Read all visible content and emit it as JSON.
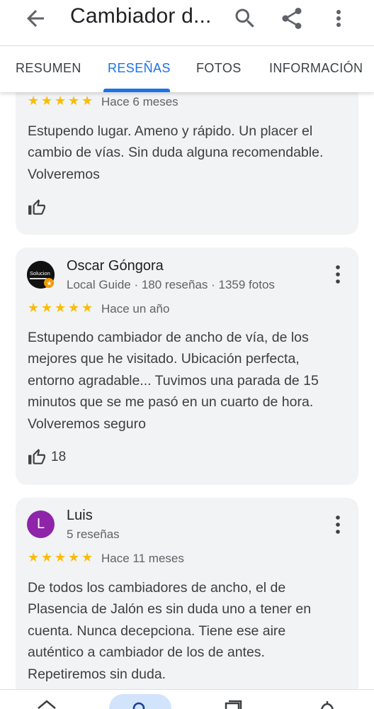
{
  "appbar": {
    "title": "Cambiador d...",
    "icons": [
      "back-arrow-icon",
      "search-icon",
      "share-icon",
      "more-vert-icon"
    ]
  },
  "tabs": [
    {
      "label": "RESUMEN",
      "active": false
    },
    {
      "label": "RESEÑAS",
      "active": true
    },
    {
      "label": "FOTOS",
      "active": false
    },
    {
      "label": "INFORMACIÓN",
      "active": false
    }
  ],
  "reviews": [
    {
      "rating": 5,
      "date": "Hace 6 meses",
      "text_lines": [
        "Estupendo lugar. Ameno y rápido. Un placer el",
        "cambio de vías. Sin duda alguna recomendable.",
        "Volveremos"
      ],
      "likes": ""
    },
    {
      "author": "Oscar Góngora",
      "author_meta": "Local Guide · 180 reseñas · 1359 fotos",
      "avatar_text": "Solucion",
      "rating": 5,
      "date": "Hace un año",
      "text_lines": [
        "Estupendo cambiador de ancho de vía, de los",
        "mejores que he visitado. Ubicación perfecta,",
        "entorno agradable... Tuvimos una parada de 15",
        "minutos que se me pasó en un cuarto de hora.",
        "Volveremos seguro"
      ],
      "likes": "18"
    },
    {
      "author": "Luis",
      "author_meta": "5 reseñas",
      "avatar_letter": "L",
      "rating": 5,
      "date": "Hace 11 meses",
      "text_lines": [
        "De todos los cambiadores de ancho, el de",
        "Plasencia de Jalón es sin duda uno a tener en",
        "cuenta. Nunca decepciona. Tiene ese aire",
        "auténtico a cambiador de los de antes.",
        "Repetiremos sin duda."
      ]
    }
  ],
  "colors": {
    "accent": "#1a73e8",
    "star": "#fbbc04",
    "card": "#f1f3f4",
    "avatar_luis": "#8e24aa"
  }
}
